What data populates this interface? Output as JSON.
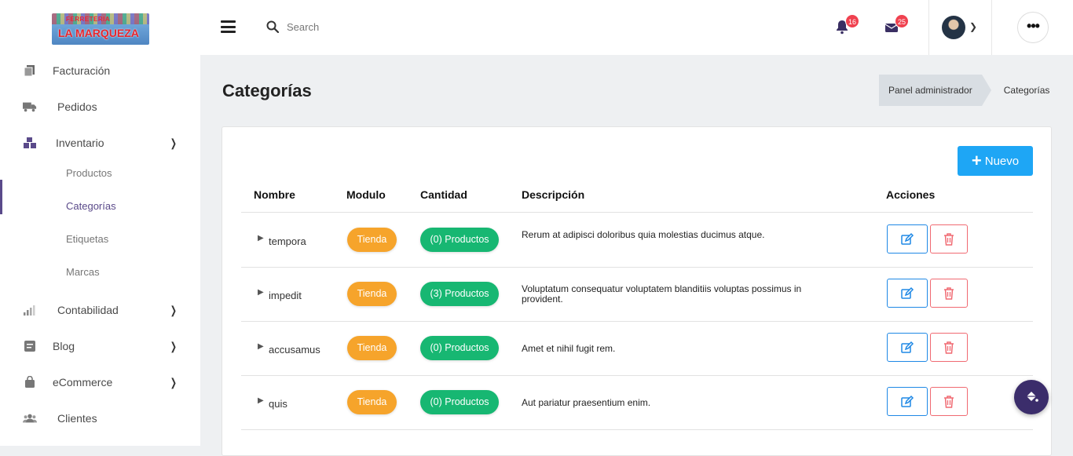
{
  "logo": {
    "top_text": "FERRETERIA",
    "name": "LA MARQUEZA"
  },
  "header": {
    "search_placeholder": "Search",
    "notifications_count": "16",
    "messages_count": "25"
  },
  "sidebar": {
    "items": [
      {
        "label": "Facturación",
        "icon": "copy-icon"
      },
      {
        "label": "Pedidos",
        "icon": "truck-icon"
      },
      {
        "label": "Inventario",
        "icon": "boxes-icon"
      },
      {
        "label": "Contabilidad",
        "icon": "signal-icon"
      },
      {
        "label": "Blog",
        "icon": "blog-icon"
      },
      {
        "label": "eCommerce",
        "icon": "bag-icon"
      },
      {
        "label": "Clientes",
        "icon": "users-icon"
      }
    ],
    "submenu": [
      "Productos",
      "Categorías",
      "Etiquetas",
      "Marcas"
    ]
  },
  "page": {
    "title": "Categorías",
    "breadcrumb": [
      "Panel administrador",
      "Categorías"
    ],
    "new_button": "Nuevo"
  },
  "table": {
    "columns": [
      "Nombre",
      "Modulo",
      "Cantidad",
      "Descripción",
      "Acciones"
    ],
    "rows": [
      {
        "name": "tempora",
        "module": "Tienda",
        "qty": "(0) Productos",
        "desc": "Rerum at adipisci doloribus quia molestias ducimus atque."
      },
      {
        "name": "impedit",
        "module": "Tienda",
        "qty": "(3) Productos",
        "desc": "Voluptatum consequatur voluptatem blanditiis voluptas possimus in provident."
      },
      {
        "name": "accusamus",
        "module": "Tienda",
        "qty": "(0) Productos",
        "desc": "Amet et nihil fugit rem."
      },
      {
        "name": "quis",
        "module": "Tienda",
        "qty": "(0) Productos",
        "desc": "Aut pariatur praesentium enim."
      }
    ]
  },
  "colors": {
    "accent": "#1ea6f5",
    "module_badge": "#f6a42b",
    "qty_badge": "#17b772",
    "active": "#5a4a8a"
  }
}
